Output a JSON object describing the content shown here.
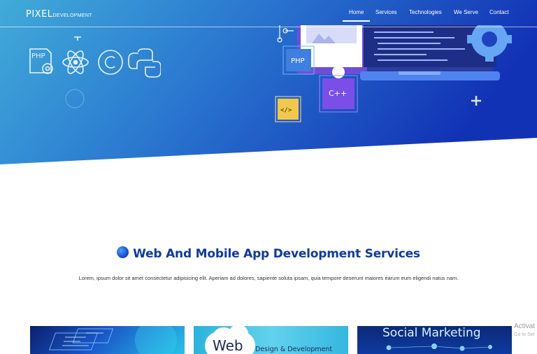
{
  "brand": {
    "name_main": "PIXEL",
    "name_sub": "DEVELOPMENT"
  },
  "nav": {
    "items": [
      {
        "label": "Home",
        "active": true
      },
      {
        "label": "Services",
        "active": false
      },
      {
        "label": "Technologies",
        "active": false
      },
      {
        "label": "We Serve",
        "active": false
      },
      {
        "label": "Contact",
        "active": false
      }
    ]
  },
  "hero": {
    "tech_icons": [
      "php-gear-icon",
      "atom-icon",
      "copyright-icon",
      "python-icon"
    ],
    "illustration_badges": {
      "php": "PHP",
      "cpp": "C++",
      "code": "</>"
    },
    "colors": {
      "gradient_start": "#3fa7d9",
      "gradient_end": "#1436b8"
    }
  },
  "services": {
    "title": "Web And Mobile App Development Services",
    "description": "Lorem, ipsum dolor sit amet consectetur adipisicing elit. Aperiam ad dolores, sapiente soluta ipsam, quia tempore deserunt maiores earum eum eligendi natus nam.",
    "cards": [
      {
        "name": "coding-card",
        "text": ""
      },
      {
        "name": "web-design-card",
        "word": "Web",
        "text": "Design & Development"
      },
      {
        "name": "social-marketing-card",
        "text": "Social Marketing"
      }
    ]
  },
  "watermark": {
    "line1": "Activat",
    "line2": "Go to Set"
  }
}
